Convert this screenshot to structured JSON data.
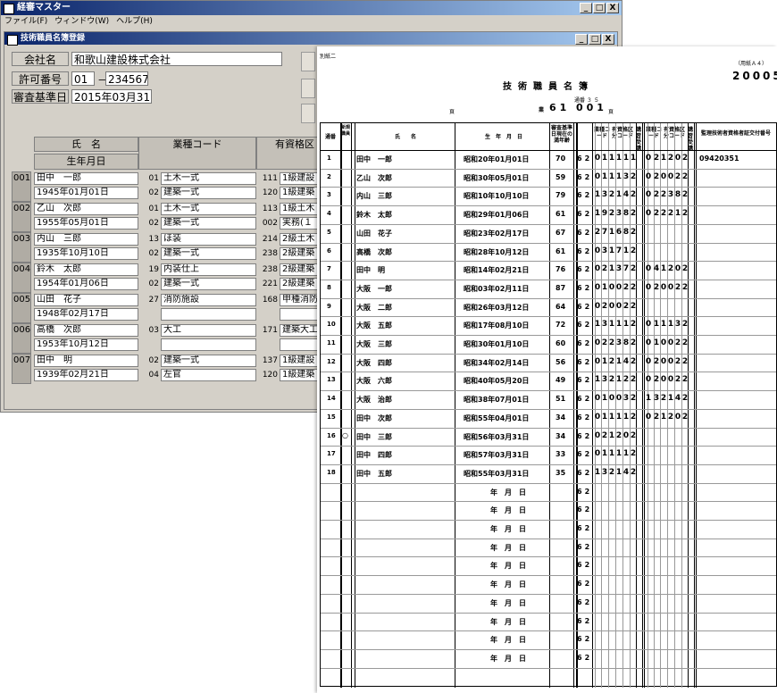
{
  "app": {
    "title": "経審マスター",
    "menu": [
      "ファイル(F)",
      "ウィンドウ(W)",
      "ヘルプ(H)"
    ],
    "child_title": "技術職員名簿登録",
    "window_buttons": [
      "_",
      "□",
      "X"
    ],
    "labels": {
      "company": "会社名",
      "license": "許可番号",
      "review_date": "審査基準日"
    },
    "values": {
      "company": "和歌山建設株式会社",
      "license_prefix": "01",
      "license_dash": "－",
      "license_number": "234567",
      "review_date": "2015年03月31日"
    },
    "grid_headers": {
      "name": "氏　名",
      "birth": "生年月日",
      "industry": "業種コード",
      "qualification": "有資格区"
    },
    "rows": [
      {
        "no": "001",
        "name": "田中　一郎",
        "birth": "1945年01月01日",
        "codes": [
          {
            "c": "01",
            "t": "土木一式"
          },
          {
            "c": "02",
            "t": "建築一式"
          }
        ],
        "quals": [
          {
            "c": "111",
            "t": "1級建設"
          },
          {
            "c": "120",
            "t": "1級建築"
          }
        ]
      },
      {
        "no": "002",
        "name": "乙山　次郎",
        "birth": "1955年05月01日",
        "codes": [
          {
            "c": "01",
            "t": "土木一式"
          },
          {
            "c": "02",
            "t": "建築一式"
          }
        ],
        "quals": [
          {
            "c": "113",
            "t": "1級土木"
          },
          {
            "c": "002",
            "t": "実務(１"
          }
        ]
      },
      {
        "no": "003",
        "name": "内山　三郎",
        "birth": "1935年10月10日",
        "codes": [
          {
            "c": "13",
            "t": "ほ装"
          },
          {
            "c": "02",
            "t": "建築一式"
          }
        ],
        "quals": [
          {
            "c": "214",
            "t": "2級土木"
          },
          {
            "c": "238",
            "t": "2級建築"
          }
        ]
      },
      {
        "no": "004",
        "name": "鈴木　太郎",
        "birth": "1954年01月06日",
        "codes": [
          {
            "c": "19",
            "t": "内装仕上"
          },
          {
            "c": "02",
            "t": "建築一式"
          }
        ],
        "quals": [
          {
            "c": "238",
            "t": "2級建築"
          },
          {
            "c": "221",
            "t": "2級建築"
          }
        ]
      },
      {
        "no": "005",
        "name": "山田　花子",
        "birth": "1948年02月17日",
        "codes": [
          {
            "c": "27",
            "t": "消防施設"
          },
          {
            "c": "",
            "t": ""
          }
        ],
        "quals": [
          {
            "c": "168",
            "t": "甲種消防"
          },
          {
            "c": "",
            "t": ""
          }
        ]
      },
      {
        "no": "006",
        "name": "高橋　次郎",
        "birth": "1953年10月12日",
        "codes": [
          {
            "c": "03",
            "t": "大工"
          },
          {
            "c": "",
            "t": ""
          }
        ],
        "quals": [
          {
            "c": "171",
            "t": "建築大工"
          },
          {
            "c": "",
            "t": ""
          }
        ]
      },
      {
        "no": "007",
        "name": "田中　明",
        "birth": "1939年02月21日",
        "codes": [
          {
            "c": "02",
            "t": "建築一式"
          },
          {
            "c": "04",
            "t": "左官"
          }
        ],
        "quals": [
          {
            "c": "137",
            "t": "1級建設"
          },
          {
            "c": "120",
            "t": "1級建築"
          }
        ]
      }
    ]
  },
  "report": {
    "form_label": "別紙二",
    "paper_note": "（用紙Ａ４）",
    "form_code": "20005",
    "title": "技術職員名簿",
    "page_label": "頁",
    "office_label": "業",
    "office_code": "61",
    "page_number": "001",
    "page_suffix": "頁",
    "top_small": "通番  ３  ５",
    "headers": {
      "seq": "通番",
      "new": "新規職員",
      "name": "氏　　名",
      "birth": "生　年　月　日",
      "age": "審査基準日現在の満年齢",
      "industry1": "業種コード",
      "qual1": "有資格区分コード",
      "lecture1": "講習受講",
      "industry2": "業種コード",
      "qual2": "有資格区分コード",
      "lecture2": "講習受講",
      "supervisor": "監理技術者資格者証交付番号"
    },
    "rows": [
      {
        "no": "1",
        "mark": "",
        "name": "田中　一郎",
        "birth": "昭和20年01月01日",
        "age": "70",
        "d": "62",
        "a": [
          "0",
          "1",
          "1",
          "1",
          "1",
          "1"
        ],
        "b": [
          "0",
          "2",
          "1",
          "2",
          "0",
          "2"
        ],
        "sup": "09420351"
      },
      {
        "no": "2",
        "mark": "",
        "name": "乙山　次郎",
        "birth": "昭和30年05月01日",
        "age": "59",
        "d": "62",
        "a": [
          "0",
          "1",
          "1",
          "1",
          "3",
          "2"
        ],
        "b": [
          "0",
          "2",
          "0",
          "0",
          "2",
          "2"
        ],
        "sup": ""
      },
      {
        "no": "3",
        "mark": "",
        "name": "内山　三郎",
        "birth": "昭和10年10月10日",
        "age": "79",
        "d": "62",
        "a": [
          "1",
          "3",
          "2",
          "1",
          "4",
          "2"
        ],
        "b": [
          "0",
          "2",
          "2",
          "3",
          "8",
          "2"
        ],
        "sup": ""
      },
      {
        "no": "4",
        "mark": "",
        "name": "鈴木　太郎",
        "birth": "昭和29年01月06日",
        "age": "61",
        "d": "62",
        "a": [
          "1",
          "9",
          "2",
          "3",
          "8",
          "2"
        ],
        "b": [
          "0",
          "2",
          "2",
          "2",
          "1",
          "2"
        ],
        "sup": ""
      },
      {
        "no": "5",
        "mark": "",
        "name": "山田　花子",
        "birth": "昭和23年02月17日",
        "age": "67",
        "d": "62",
        "a": [
          "2",
          "7",
          "1",
          "6",
          "8",
          "2"
        ],
        "b": [],
        "sup": ""
      },
      {
        "no": "6",
        "mark": "",
        "name": "高橋　次郎",
        "birth": "昭和28年10月12日",
        "age": "61",
        "d": "62",
        "a": [
          "0",
          "3",
          "1",
          "7",
          "1",
          "2"
        ],
        "b": [],
        "sup": ""
      },
      {
        "no": "7",
        "mark": "",
        "name": "田中　明",
        "birth": "昭和14年02月21日",
        "age": "76",
        "d": "62",
        "a": [
          "0",
          "2",
          "1",
          "3",
          "7",
          "2"
        ],
        "b": [
          "0",
          "4",
          "1",
          "2",
          "0",
          "2"
        ],
        "sup": ""
      },
      {
        "no": "8",
        "mark": "",
        "name": "大阪　一郎",
        "birth": "昭和03年02月11日",
        "age": "87",
        "d": "62",
        "a": [
          "0",
          "1",
          "0",
          "0",
          "2",
          "2"
        ],
        "b": [
          "0",
          "2",
          "0",
          "0",
          "2",
          "2"
        ],
        "sup": ""
      },
      {
        "no": "9",
        "mark": "",
        "name": "大阪　二郎",
        "birth": "昭和26年03月12日",
        "age": "64",
        "d": "62",
        "a": [
          "0",
          "2",
          "0",
          "0",
          "2",
          "2"
        ],
        "b": [],
        "sup": ""
      },
      {
        "no": "10",
        "mark": "",
        "name": "大阪　五郎",
        "birth": "昭和17年08月10日",
        "age": "72",
        "d": "62",
        "a": [
          "1",
          "3",
          "1",
          "1",
          "1",
          "2"
        ],
        "b": [
          "0",
          "1",
          "1",
          "1",
          "3",
          "2"
        ],
        "sup": ""
      },
      {
        "no": "11",
        "mark": "",
        "name": "大阪　三郎",
        "birth": "昭和30年01月10日",
        "age": "60",
        "d": "62",
        "a": [
          "0",
          "2",
          "2",
          "3",
          "8",
          "2"
        ],
        "b": [
          "0",
          "1",
          "0",
          "0",
          "2",
          "2"
        ],
        "sup": ""
      },
      {
        "no": "12",
        "mark": "",
        "name": "大阪　四郎",
        "birth": "昭和34年02月14日",
        "age": "56",
        "d": "62",
        "a": [
          "0",
          "1",
          "2",
          "1",
          "4",
          "2"
        ],
        "b": [
          "0",
          "2",
          "0",
          "0",
          "2",
          "2"
        ],
        "sup": ""
      },
      {
        "no": "13",
        "mark": "",
        "name": "大阪　六郎",
        "birth": "昭和40年05月20日",
        "age": "49",
        "d": "62",
        "a": [
          "1",
          "3",
          "2",
          "1",
          "2",
          "2"
        ],
        "b": [
          "0",
          "2",
          "0",
          "0",
          "2",
          "2"
        ],
        "sup": ""
      },
      {
        "no": "14",
        "mark": "",
        "name": "大阪　治郎",
        "birth": "昭和38年07月01日",
        "age": "51",
        "d": "62",
        "a": [
          "0",
          "1",
          "0",
          "0",
          "3",
          "2"
        ],
        "b": [
          "1",
          "3",
          "2",
          "1",
          "4",
          "2"
        ],
        "sup": ""
      },
      {
        "no": "15",
        "mark": "",
        "name": "田中　次郎",
        "birth": "昭和55年04月01日",
        "age": "34",
        "d": "62",
        "a": [
          "0",
          "1",
          "1",
          "1",
          "1",
          "2"
        ],
        "b": [
          "0",
          "2",
          "1",
          "2",
          "0",
          "2"
        ],
        "sup": ""
      },
      {
        "no": "16",
        "mark": "○",
        "name": "田中　三郎",
        "birth": "昭和56年03月31日",
        "age": "34",
        "d": "62",
        "a": [
          "0",
          "2",
          "1",
          "2",
          "0",
          "2"
        ],
        "b": [],
        "sup": ""
      },
      {
        "no": "17",
        "mark": "",
        "name": "田中　四郎",
        "birth": "昭和57年03月31日",
        "age": "33",
        "d": "62",
        "a": [
          "0",
          "1",
          "1",
          "1",
          "1",
          "2"
        ],
        "b": [],
        "sup": ""
      },
      {
        "no": "18",
        "mark": "",
        "name": "田中　五郎",
        "birth": "昭和55年03月31日",
        "age": "35",
        "d": "62",
        "a": [
          "1",
          "3",
          "2",
          "1",
          "4",
          "2"
        ],
        "b": [],
        "sup": ""
      }
    ],
    "empty_birth": "年　月　日",
    "empty_d": "62"
  }
}
